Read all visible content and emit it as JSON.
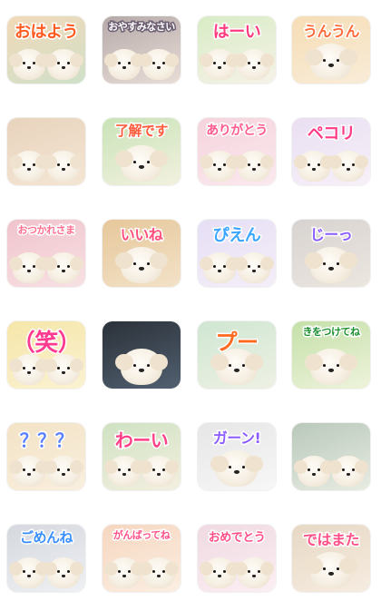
{
  "stickers": [
    {
      "label": "おはよう",
      "color": "#ff5a1f",
      "bg": [
        "#f2d9b8",
        "#cfe0c9"
      ],
      "pups": 2,
      "size": 18
    },
    {
      "label": "おやすみなさい",
      "color": "#ffffff",
      "bg": [
        "#b5aaa8",
        "#e9ddd8"
      ],
      "pups": 2,
      "size": 11,
      "stroke": "#6c5f73"
    },
    {
      "label": "はーい",
      "color": "#ff3b7f",
      "bg": [
        "#d8ecc5",
        "#f6f2e8"
      ],
      "pups": 2,
      "size": 18
    },
    {
      "label": "うんうん",
      "color": "#ff6a3a",
      "bg": [
        "#f6ddb5",
        "#f8ecd8"
      ],
      "pups": 1,
      "size": 16
    },
    {
      "label": "",
      "color": "#ffffff",
      "bg": [
        "#e8d3bd",
        "#f4e6d4"
      ],
      "pups": 2,
      "size": 14
    },
    {
      "label": "了解です",
      "color": "#ff5a3a",
      "bg": [
        "#c9e3b8",
        "#f2f1df"
      ],
      "pups": 1,
      "size": 15
    },
    {
      "label": "ありがとう",
      "color": "#ff5b8e",
      "bg": [
        "#f5d3dd",
        "#fbe9ee"
      ],
      "pups": 2,
      "size": 14
    },
    {
      "label": "ペコリ",
      "color": "#ff3a86",
      "bg": [
        "#e9dff2",
        "#f7f0f8"
      ],
      "pups": 2,
      "size": 18
    },
    {
      "label": "おつかれさま",
      "color": "#ff6f8f",
      "bg": [
        "#f0c3cd",
        "#f7e1e3"
      ],
      "pups": 2,
      "size": 11
    },
    {
      "label": "いいね",
      "color": "#ff4f7a",
      "bg": [
        "#e6c79a",
        "#f3e2c8"
      ],
      "pups": 1,
      "size": 16
    },
    {
      "label": "ぴえん",
      "color": "#3aa6ff",
      "bg": [
        "#e6dff5",
        "#f4eef8"
      ],
      "pups": 2,
      "size": 18
    },
    {
      "label": "じーっ",
      "color": "#8a5cff",
      "bg": [
        "#d7d3d0",
        "#ece6e0"
      ],
      "pups": 1,
      "size": 16
    },
    {
      "label": "（笑）",
      "color": "#ff3b8f",
      "bg": [
        "#f5e6a8",
        "#fbf2d2"
      ],
      "pups": 2,
      "size": 26
    },
    {
      "label": "",
      "color": "#ffffff",
      "bg": [
        "#2b3139",
        "#516070"
      ],
      "pups": 1,
      "size": 14
    },
    {
      "label": "プー",
      "color": "#ff6a1f",
      "bg": [
        "#cfe6d2",
        "#eef1e4"
      ],
      "pups": 1,
      "size": 24
    },
    {
      "label": "きをつけてね",
      "color": "#1a8f2e",
      "bg": [
        "#c4e0a8",
        "#eef3dc"
      ],
      "pups": 1,
      "size": 11
    },
    {
      "label": "？？？",
      "color": "#5a7fff",
      "bg": [
        "#f3e3c6",
        "#f9efde"
      ],
      "pups": 2,
      "size": 20
    },
    {
      "label": "わーい",
      "color": "#ff3f86",
      "bg": [
        "#cfe2c2",
        "#f3efe0"
      ],
      "pups": 2,
      "size": 20
    },
    {
      "label": "ガーン!",
      "color": "#8b5bff",
      "bg": [
        "#e6e6e6",
        "#f7f7f7"
      ],
      "pups": 1,
      "size": 16
    },
    {
      "label": "",
      "color": "#ffffff",
      "bg": [
        "#b9c8bb",
        "#e8ece2"
      ],
      "pups": 2,
      "size": 14
    },
    {
      "label": "ごめんね",
      "color": "#3a8fff",
      "bg": [
        "#d5d8de",
        "#eef0f3"
      ],
      "pups": 2,
      "size": 15
    },
    {
      "label": "がんばってね",
      "color": "#ff4f86",
      "bg": [
        "#f6d7c0",
        "#fbeee2"
      ],
      "pups": 2,
      "size": 11
    },
    {
      "label": "おめでとう",
      "color": "#ff4f86",
      "bg": [
        "#f0d9e2",
        "#fbeff3"
      ],
      "pups": 2,
      "size": 13
    },
    {
      "label": "ではまた",
      "color": "#ff4f86",
      "bg": [
        "#e7d8c5",
        "#f6ece0"
      ],
      "pups": 1,
      "size": 16
    }
  ]
}
